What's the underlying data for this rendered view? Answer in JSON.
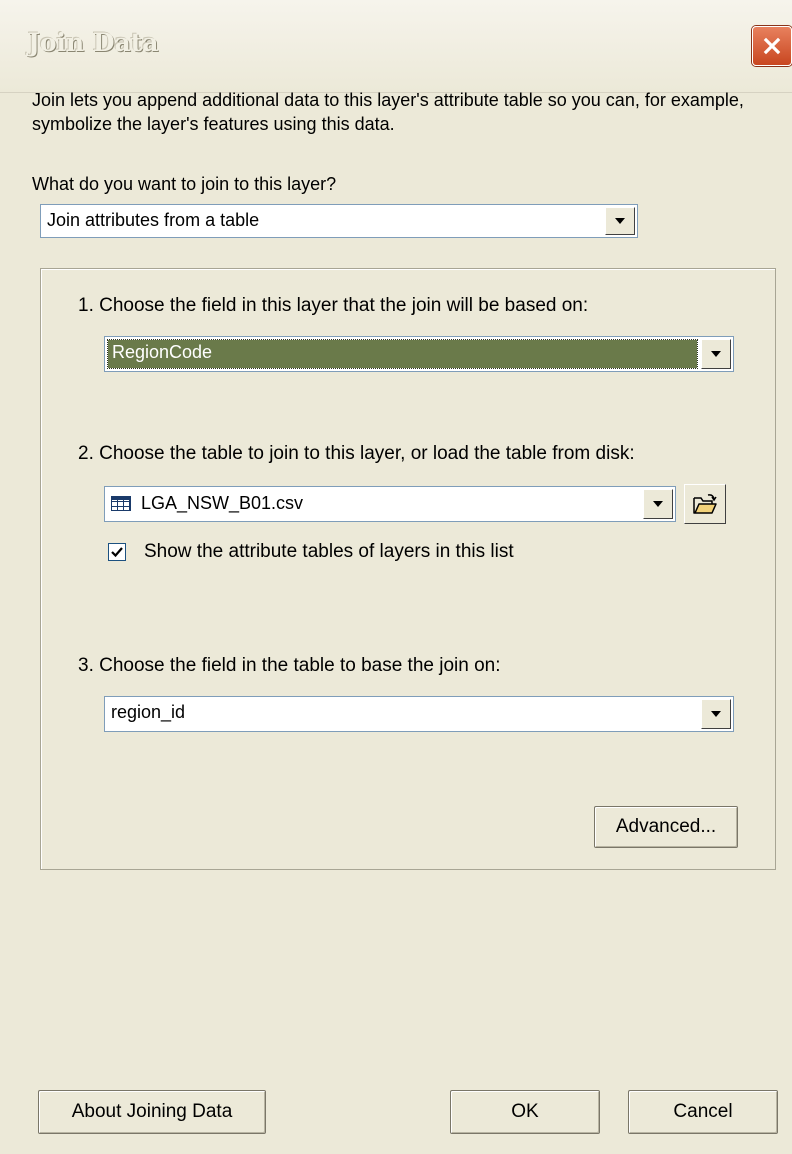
{
  "window": {
    "title": "Join Data"
  },
  "intro": "Join lets you append additional data to this layer's attribute table so you can, for example, symbolize the layer's features using this data.",
  "join_question": "What do you want to join to this layer?",
  "join_type": {
    "value": "Join attributes from a table"
  },
  "step1": {
    "label": "1. Choose the field in this layer that the join will be based on:",
    "value": "RegionCode"
  },
  "step2": {
    "label": "2. Choose the table to join to this layer, or load the table from disk:",
    "value": "LGA_NSW_B01.csv",
    "checkbox_label": "Show the attribute tables of layers in this list",
    "checkbox_checked": true
  },
  "step3": {
    "label": "3. Choose the field in the table to base the join on:",
    "value": "region_id"
  },
  "buttons": {
    "advanced": "Advanced...",
    "about": "About Joining Data",
    "ok": "OK",
    "cancel": "Cancel"
  }
}
